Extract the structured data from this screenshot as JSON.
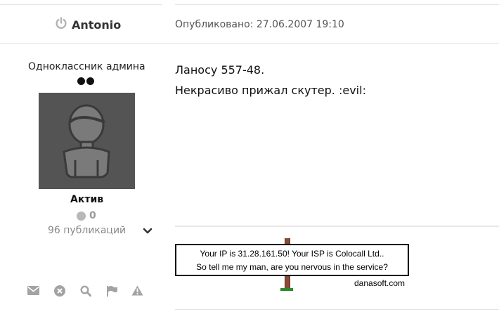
{
  "post": {
    "author": "Antonio",
    "published": "Опубликовано: 27.06.2007 19:10",
    "rank": "Одноклассник админа",
    "status": "Актив",
    "reputation": "0",
    "posts_count": "96 публикаций",
    "lines": [
      "Ланосу 557-48.",
      "Некрасиво прижал скутер. :evil:"
    ]
  },
  "signature": {
    "line1": "Your IP is 31.28.161.50! Your ISP is Colocall Ltd..",
    "line2": "So tell me my man, are you nervous in the service?",
    "site": "danasoft.com"
  },
  "icons": {
    "online": "power-icon",
    "expand": "chevron-down-icon",
    "actions": [
      "envelope-icon",
      "close-circle-icon",
      "search-icon",
      "flag-icon",
      "warning-icon"
    ]
  },
  "colors": {
    "avatar_bg": "#545454",
    "muted": "#999999"
  }
}
